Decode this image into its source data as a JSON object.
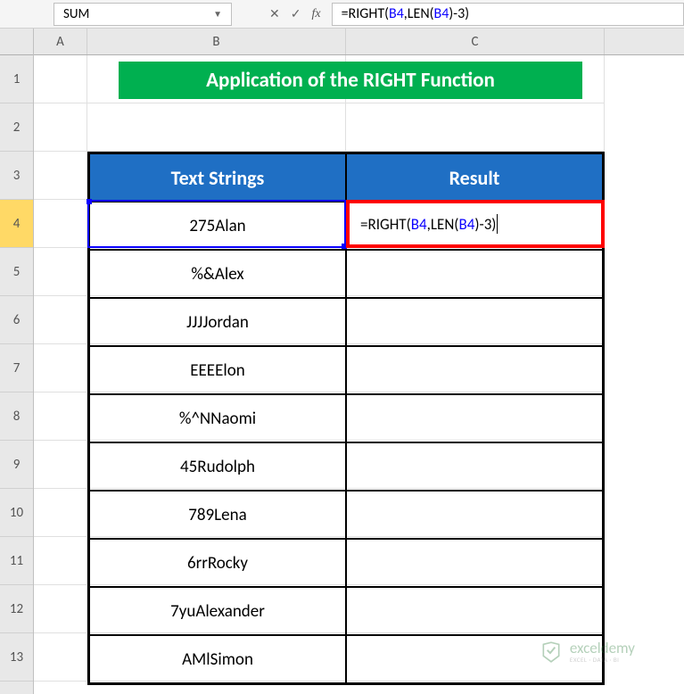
{
  "name_box": "SUM",
  "formula_bar": {
    "cancel": "✕",
    "enter": "✓",
    "fx": "fx",
    "formula_prefix": "=RIGHT(",
    "ref1": "B4",
    "mid": ",LEN(",
    "ref2": "B4",
    "suffix": ")-3)"
  },
  "cell_edit": {
    "prefix": "=RIGHT(",
    "ref1": "B4",
    "mid": ",LEN(",
    "ref2": "B4",
    "suffix": ")-3)"
  },
  "columns": [
    "A",
    "B",
    "C"
  ],
  "rows": [
    "1",
    "2",
    "3",
    "4",
    "5",
    "6",
    "7",
    "8",
    "9",
    "10",
    "11",
    "12",
    "13"
  ],
  "active_row": "4",
  "title": "Application of the RIGHT Function",
  "headers": {
    "col1": "Text Strings",
    "col2": "Result"
  },
  "data": [
    "275Alan",
    "%&Alex",
    "JJJJordan",
    "EEEElon",
    "%^NNaomi",
    "45Rudolph",
    "789Lena",
    "6rrRocky",
    "7yuAlexander",
    "AMlSimon"
  ],
  "watermark": {
    "name": "exceldemy",
    "sub": "EXCEL · DATA · BI"
  }
}
